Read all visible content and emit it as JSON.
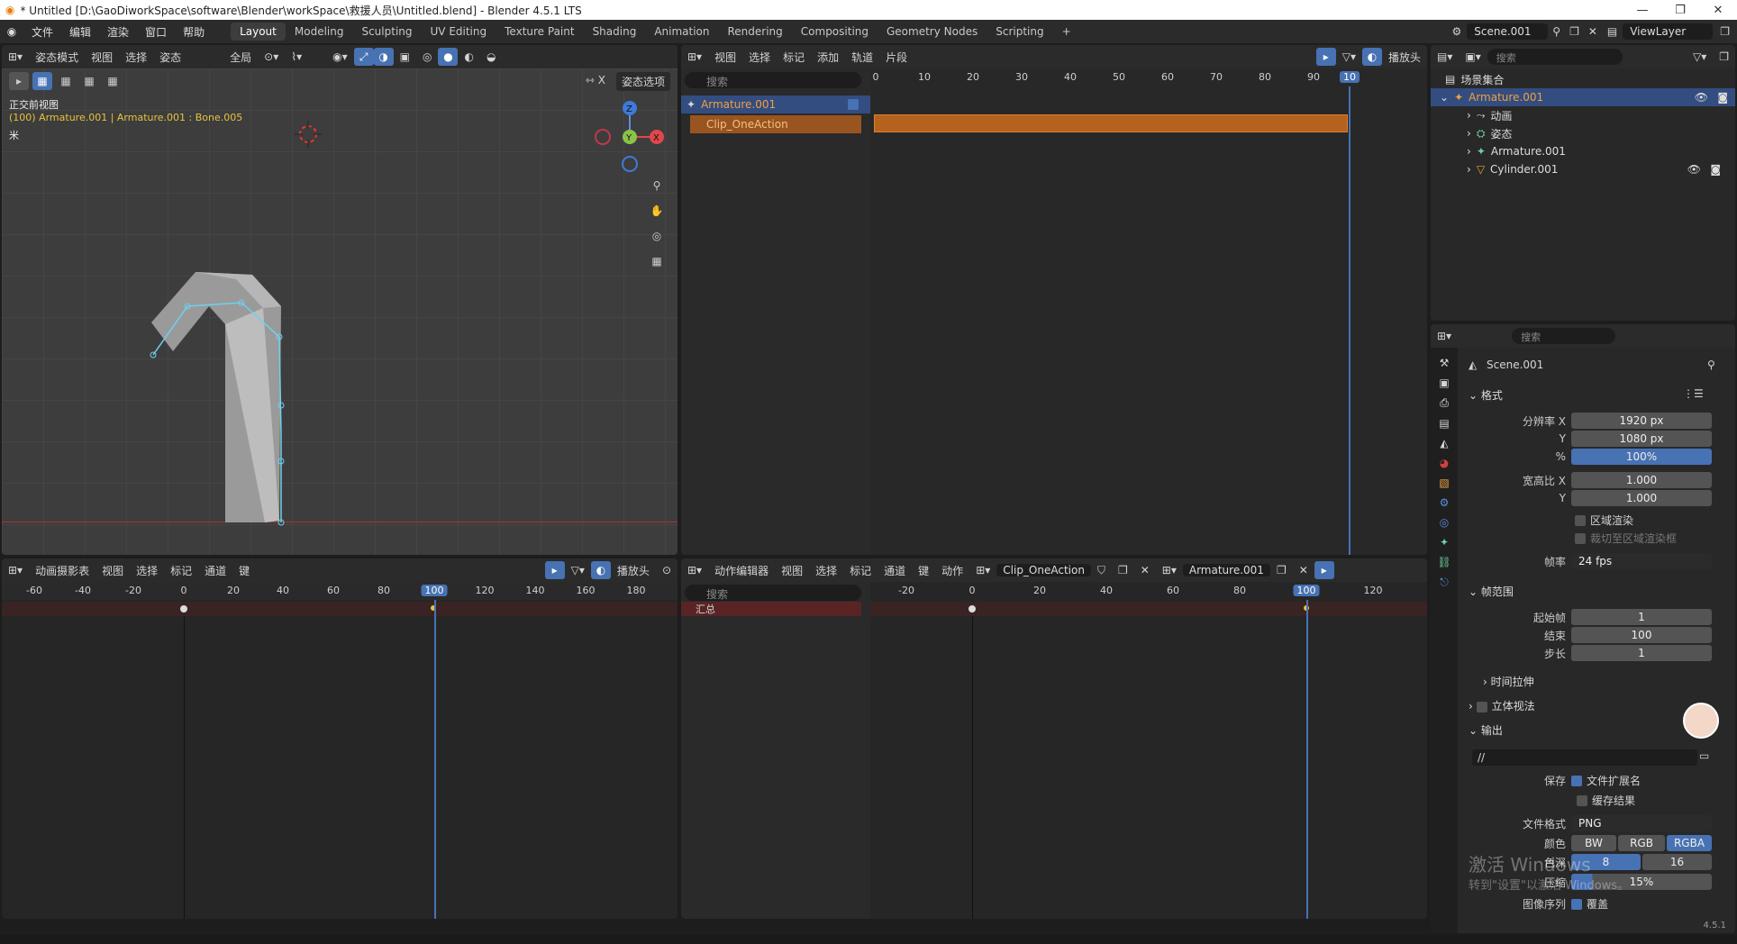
{
  "window": {
    "title": "* Untitled [D:\\GaoDiworkSpace\\software\\Blender\\workSpace\\救援人员\\Untitled.blend] - Blender 4.5.1 LTS",
    "min": "—",
    "max": "❐",
    "close": "✕"
  },
  "menu": [
    "文件",
    "编辑",
    "渲染",
    "窗口",
    "帮助"
  ],
  "workspaces": [
    "Layout",
    "Modeling",
    "Sculpting",
    "UV Editing",
    "Texture Paint",
    "Shading",
    "Animation",
    "Rendering",
    "Compositing",
    "Geometry Nodes",
    "Scripting"
  ],
  "scene": {
    "name": "Scene.001",
    "viewlayer": "ViewLayer"
  },
  "viewport": {
    "mode": "姿态模式",
    "menus": [
      "视图",
      "选择",
      "姿态"
    ],
    "transform": "全局",
    "overlay_label": "正交前视图",
    "info": "(100) Armature.001 | Armature.001 : Bone.005",
    "options": "姿态选项",
    "unit": "米",
    "axis_z": "Z",
    "axis_y": "Y",
    "axis_x": "X"
  },
  "nla": {
    "menus": [
      "视图",
      "选择",
      "标记",
      "添加",
      "轨道",
      "片段"
    ],
    "search_placeholder": "搜索",
    "playback": "播放头",
    "track": "Armature.001",
    "strip": "Clip_OneAction",
    "ticks": [
      "0",
      "10",
      "20",
      "30",
      "40",
      "50",
      "60",
      "70",
      "80",
      "90"
    ],
    "current": "10"
  },
  "dopesheet_left": {
    "mode": "动画摄影表",
    "menus": [
      "视图",
      "选择",
      "标记",
      "通道",
      "键"
    ],
    "playback": "播放头",
    "ticks": [
      "-60",
      "-40",
      "-20",
      "0",
      "20",
      "40",
      "60",
      "80"
    ],
    "current": "100",
    "ticks_after": [
      "120",
      "140",
      "160",
      "180"
    ]
  },
  "dopesheet_right": {
    "mode": "动作编辑器",
    "menus": [
      "视图",
      "选择",
      "标记",
      "通道",
      "键",
      "动作"
    ],
    "action": "Clip_OneAction",
    "object": "Armature.001",
    "search_placeholder": "搜索",
    "summary": "汇总",
    "ticks": [
      "-20",
      "0",
      "20",
      "40",
      "60",
      "80"
    ],
    "current": "100",
    "ticks_after": [
      "120"
    ]
  },
  "outliner": {
    "search_placeholder": "搜索",
    "root": "场景集合",
    "items": [
      {
        "name": "Armature.001",
        "indent": 0
      },
      {
        "name": "动画",
        "indent": 1
      },
      {
        "name": "姿态",
        "indent": 1
      },
      {
        "name": "Armature.001",
        "indent": 1
      },
      {
        "name": "Cylinder.001",
        "indent": 0
      }
    ]
  },
  "properties": {
    "search_placeholder": "搜索",
    "scene": "Scene.001",
    "format_title": "格式",
    "res_x_label": "分辨率 X",
    "res_x": "1920 px",
    "res_y_label": "Y",
    "res_y": "1080 px",
    "pct_label": "%",
    "pct": "100%",
    "aspect_x_label": "宽高比 X",
    "aspect_x": "1.000",
    "aspect_y_label": "Y",
    "aspect_y": "1.000",
    "region": "区域渲染",
    "crop": "裁切至区域渲染框",
    "fps_label": "帧率",
    "fps": "24 fps",
    "frame_range_title": "帧范围",
    "start_label": "起始帧",
    "start": "1",
    "end_label": "结束",
    "end": "100",
    "step_label": "步长",
    "step": "1",
    "time_stretch": "时间拉伸",
    "stereo": "立体视法",
    "output_title": "输出",
    "path": "//",
    "save_label": "保存",
    "file_ext": "文件扩展名",
    "cache": "缓存结果",
    "format_label": "文件格式",
    "format": "PNG",
    "color_label": "颜色",
    "bw": "BW",
    "rgb": "RGB",
    "rgba": "RGBA",
    "depth_label": "色深",
    "d8": "8",
    "d16": "16",
    "compress_label": "压缩",
    "compress": "15%",
    "seq_label": "图像序列",
    "overwrite": "覆盖",
    "version": "4.5.1"
  },
  "watermark": {
    "line1": "激活 Windows",
    "line2": "转到\"设置\"以激活 Windows。"
  }
}
